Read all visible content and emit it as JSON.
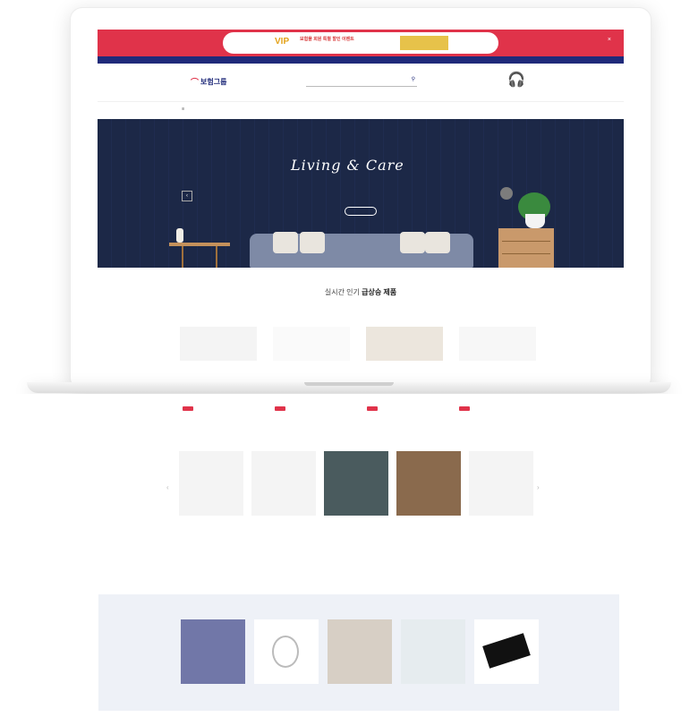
{
  "promo": {
    "vip": "VIP",
    "line1": "보험몰 회원 특별 할인 이벤트",
    "line2": "",
    "close": "×"
  },
  "topnav": {
    "left": "",
    "links": [
      "",
      "",
      "",
      "",
      ""
    ]
  },
  "header": {
    "logo_text": "보험그룹",
    "search_placeholder": "",
    "promo_text": ""
  },
  "menu": {
    "items": [
      "",
      "",
      "",
      "",
      "",
      "",
      ""
    ]
  },
  "hero": {
    "title": "Living & Care",
    "subtitle": "",
    "button": "",
    "prev_arrow": "‹"
  },
  "section1": {
    "title_plain": "실시간 인기 ",
    "title_bold": "급상승 제품",
    "subtitle": ""
  },
  "strip_items": [
    {
      "name": "",
      "price": "",
      "old": ""
    },
    {
      "name": "",
      "price": "",
      "old": ""
    },
    {
      "name": "",
      "price": "",
      "old": ""
    },
    {
      "name": "",
      "price": "",
      "old": ""
    }
  ],
  "categories": [
    {
      "label": "",
      "sub": ""
    },
    {
      "label": "",
      "sub": ""
    },
    {
      "label": "",
      "sub": ""
    },
    {
      "label": "",
      "sub": ""
    },
    {
      "label": "",
      "sub": ""
    }
  ],
  "section2": {
    "title_plain": "",
    "title_bold": "",
    "subtitle": ""
  },
  "tiles": {
    "blue_text": ""
  },
  "colors": {
    "brand_red": "#e0334a",
    "brand_navy": "#1f2a7a",
    "hero_bg": "#1c2847"
  }
}
